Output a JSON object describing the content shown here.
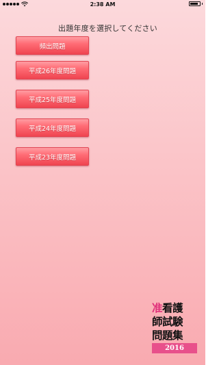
{
  "status_bar": {
    "time": "2:38 AM",
    "battery_level": 0.85,
    "icons": [
      "signal-dots-icon",
      "wifi-icon",
      "battery-icon"
    ]
  },
  "prompt": "出題年度を選択してください",
  "buttons": [
    {
      "label": "頻出問題"
    },
    {
      "label": "平成26年度問題"
    },
    {
      "label": "平成25年度問題"
    },
    {
      "label": "平成24年度問題"
    },
    {
      "label": "平成23年度問題"
    }
  ],
  "logo": {
    "line1_accent": "准",
    "line1_rest": "看護",
    "line2": "師試験",
    "line3": "問題集",
    "year": "2016"
  },
  "colors": {
    "background_top": "#fcd9dc",
    "background_bottom": "#f9aab0",
    "button": "#ff6c75",
    "logo_accent": "#e0317a",
    "logo_year_bg": "#e8508b"
  }
}
